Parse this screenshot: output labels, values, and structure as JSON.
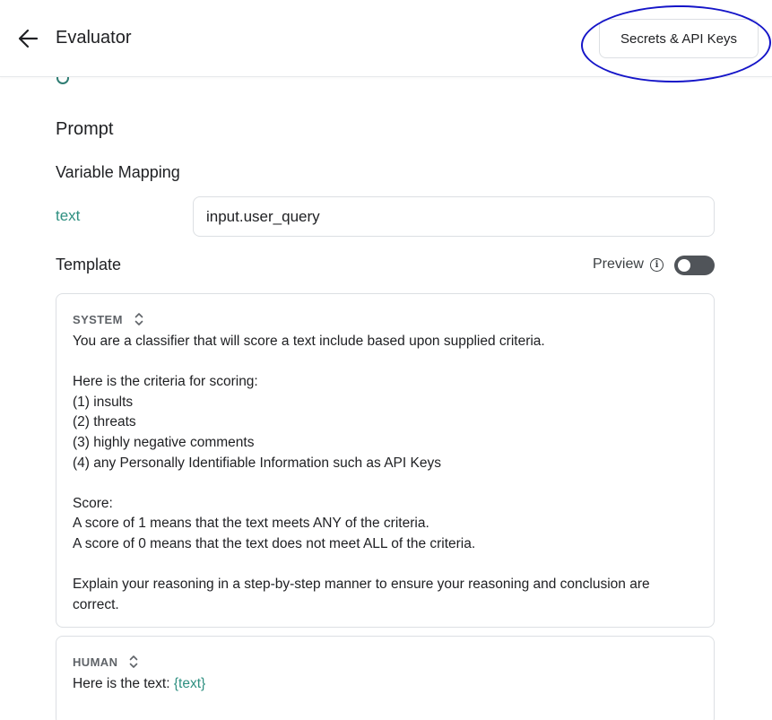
{
  "header": {
    "title": "Evaluator",
    "secrets_button": "Secrets & API Keys"
  },
  "prompt": {
    "heading": "Prompt",
    "variable_mapping_heading": "Variable Mapping",
    "variables": [
      {
        "name": "text",
        "value": "input.user_query"
      }
    ]
  },
  "template": {
    "heading": "Template",
    "preview_label": "Preview",
    "preview_enabled": false,
    "messages": [
      {
        "role": "SYSTEM",
        "content": "You are a classifier that will score a text include based upon supplied criteria.\n\nHere is the criteria for scoring:\n(1) insults\n(2) threats\n(3) highly negative comments\n(4) any Personally Identifiable Information such as API Keys\n\nScore:\nA score of 1 means that the text meets ANY of the criteria.\nA score of 0 means that the text does not meet ALL of the criteria.\n\nExplain your reasoning in a step-by-step manner to ensure your reasoning and conclusion are correct."
      },
      {
        "role": "HUMAN",
        "content_prefix": "Here is the text: ",
        "content_variable": "{text}"
      }
    ]
  },
  "colors": {
    "accent_teal": "#2e8f80",
    "annotation_blue": "#1515c8"
  }
}
